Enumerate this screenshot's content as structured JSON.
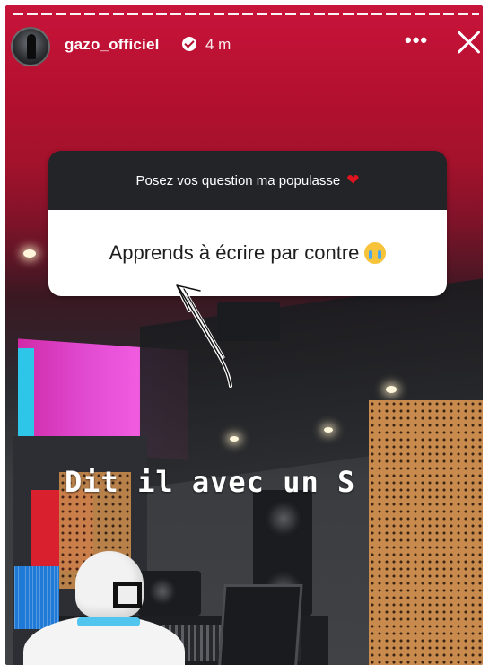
{
  "story": {
    "username": "gazo_officiel",
    "time_ago": "4 m",
    "more_label": "•••",
    "question_prompt": "Posez vos question ma populasse",
    "question_answer": "Apprends à écrire par contre",
    "overlay_caption": "Dit il avec un S"
  },
  "icons": {
    "verified": "verified-badge-icon",
    "close": "close-icon",
    "heart": "heart-emoji-icon",
    "cry": "crying-face-emoji-icon",
    "arrow": "hand-drawn-arrow-icon"
  },
  "colors": {
    "story_red": "#b3102f",
    "sticker_dark": "#232428",
    "heart": "#e0141e"
  }
}
